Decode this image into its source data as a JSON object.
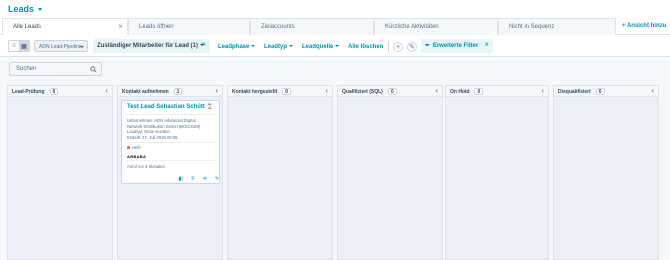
{
  "header": {
    "title": "Leads"
  },
  "tabs": [
    {
      "label": "Alle Leads"
    },
    {
      "label": "Leads öffnen"
    },
    {
      "label": "Zielaccounts"
    },
    {
      "label": "Kürzliche Aktivitäten"
    },
    {
      "label": "Nicht in Sequenz"
    }
  ],
  "add_view_label": "+ Ansicht hinzu",
  "toolbar": {
    "pipeline_select": "ADN Lead-Pipeline",
    "owner_chip": "Zuständiger Mitarbeiter für Lead (1)",
    "filters": [
      {
        "label": "Leadphase"
      },
      {
        "label": "Leadtyp"
      },
      {
        "label": "Leadquelle"
      }
    ],
    "clear_all": "Alle löschen",
    "advanced_filters": "Erweiterte Filter"
  },
  "search": {
    "placeholder": "Suchen"
  },
  "columns": [
    {
      "name": "Lead-Prüfung",
      "count": "0"
    },
    {
      "name": "Kontakt aufnehmen",
      "count": "1"
    },
    {
      "name": "Kontakt hergestellt",
      "count": "0"
    },
    {
      "name": "Qualifiziert (SQL)",
      "count": "0"
    },
    {
      "name": "On Hold",
      "count": "0"
    },
    {
      "name": "Disqualifiziert",
      "count": "0"
    }
  ],
  "card": {
    "title": "Test Lead Sebastian Schütt",
    "company_line1": "Unternehmen: ADN Advanced Digital",
    "company_line2": "Network Distribution GmbH (BOCHUM)",
    "lead_type": "Leadtyp: Neue Kunden",
    "created": "Erstellt: 27. Juli 2026 09:55",
    "temperature": "Heiß",
    "owner_obscured": "ARBABA",
    "last_activity": "Anruf vor 6 Monaten"
  },
  "colors": {
    "accent": "#0091ae",
    "hot": "#f2545b"
  }
}
